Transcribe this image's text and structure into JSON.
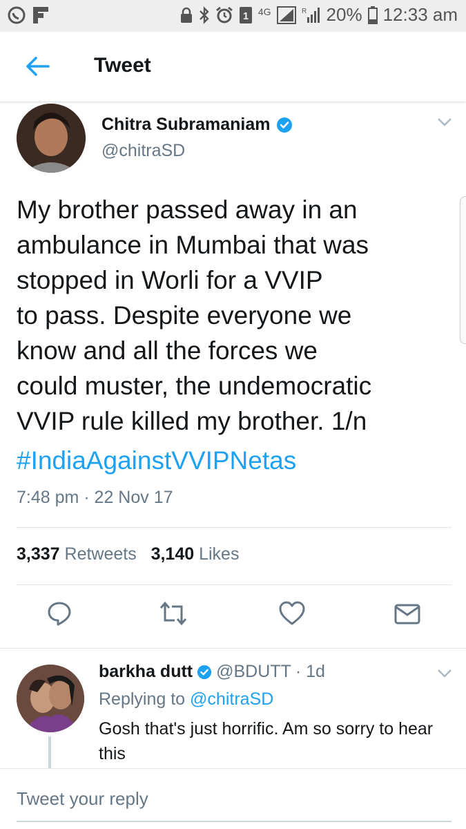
{
  "status_bar": {
    "network": "4G",
    "battery": "20%",
    "time": "12:33 am",
    "icons": [
      "whatsapp-icon",
      "flipboard-icon",
      "lock-icon",
      "bluetooth-icon",
      "alarm-icon",
      "sim-1-icon",
      "signal-icon",
      "roaming-signal-icon",
      "battery-icon"
    ]
  },
  "app_bar": {
    "title": "Tweet",
    "back_icon": "arrow-left-icon"
  },
  "tweet": {
    "author_name": "Chitra Subramaniam",
    "handle": "@chitraSD",
    "verified": true,
    "text_lines": [
      "My brother passed away in an",
      "ambulance in Mumbai that was",
      "stopped in Worli for a VVIP",
      "to pass. Despite everyone we",
      "know and all the forces we",
      "could muster, the undemocratic",
      "VVIP rule killed my brother. 1/n"
    ],
    "hashtag": "#IndiaAgainstVVIPNetas",
    "timestamp": "7:48 pm · 22 Nov 17",
    "retweets_count": "3,337",
    "retweets_label": "Retweets",
    "likes_count": "3,140",
    "likes_label": "Likes"
  },
  "actions": {
    "reply_icon": "reply-icon",
    "retweet_icon": "retweet-icon",
    "like_icon": "heart-icon",
    "dm_icon": "envelope-icon"
  },
  "reply": {
    "author_name": "barkha dutt",
    "handle": "@BDUTT",
    "age": "· 1d",
    "replying_prefix": "Replying to",
    "replying_handle": "@chitraSD",
    "text": "Gosh that's just horrific. Am so sorry to hear this"
  },
  "compose": {
    "placeholder": "Tweet your reply"
  },
  "colors": {
    "accent": "#1da1f2",
    "muted": "#657786",
    "text": "#14171a",
    "divider": "#e1e8ed"
  }
}
